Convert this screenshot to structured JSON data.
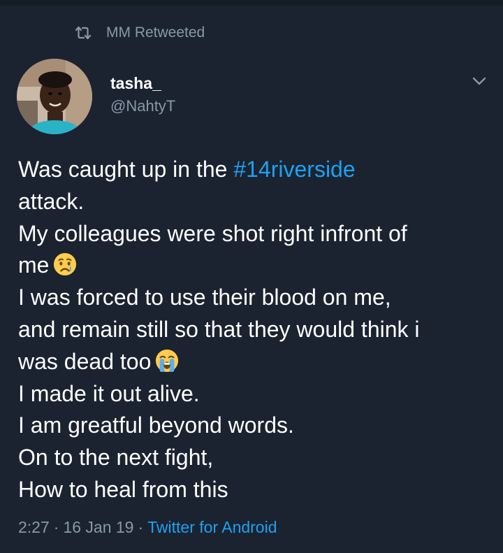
{
  "retweet": {
    "icon": "retweet-icon",
    "text": "MM Retweeted"
  },
  "author": {
    "display_name": "tasha_",
    "handle": "@NahtyT",
    "avatar": "avatar-photo"
  },
  "menu_icon": "chevron-down-icon",
  "tweet": {
    "lines": {
      "l1_prefix": "Was caught up in the ",
      "l1_hashtag": "#14riverside",
      "l2": "attack.",
      "l3": "My colleagues were shot right infront of",
      "l4": "me",
      "l4_emoji": "crying-face-emoji",
      "l5": "I was forced to use their blood on me,",
      "l6": "and remain still so that they would think i",
      "l7": "was dead too",
      "l7_emoji": "loudly-crying-face-emoji",
      "l8": "I made it out alive.",
      "l9": "I am greatful beyond words.",
      "l10": "On to the next fight,",
      "l11": "How to heal from this"
    }
  },
  "meta": {
    "time": "2:27",
    "separator": "·",
    "date": "16 Jan 19",
    "client": "Twitter for Android"
  },
  "colors": {
    "background": "#1b2330",
    "text": "#ffffff",
    "secondary": "#8899a6",
    "link": "#1da1f2"
  }
}
